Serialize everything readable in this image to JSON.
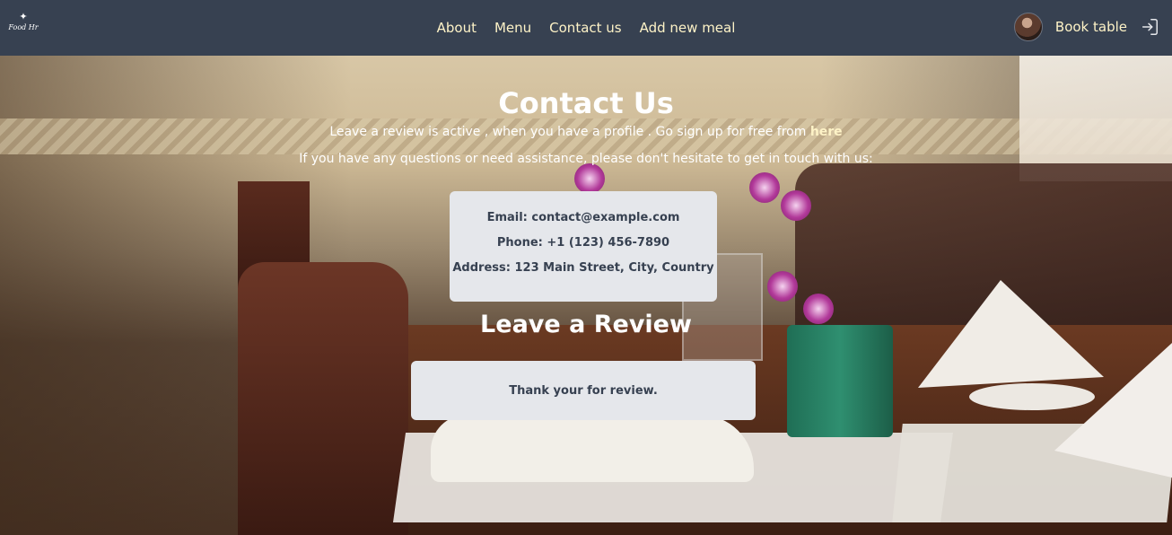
{
  "nav": {
    "logo_text": "Food Hr",
    "links": [
      "About",
      "Menu",
      "Contact us",
      "Add new meal"
    ],
    "book_table": "Book table",
    "login_icon": "login-icon"
  },
  "contact": {
    "title": "Contact Us",
    "review_notice_prefix": "Leave a review is active , when you have a profile . Go sign up for free from ",
    "review_notice_link": "here",
    "assistance": "If you have any questions or need assistance, please don't hesitate to get in touch with us:",
    "email": "Email: contact@example.com",
    "phone": "Phone: +1 (123) 456-7890",
    "address": "Address: 123 Main Street, City, Country"
  },
  "review": {
    "title": "Leave a Review",
    "message": "Thank your for review."
  },
  "colors": {
    "navbar": "#374151",
    "nav_link": "#fef3c7",
    "card": "#e5e7eb",
    "card_text": "#374151"
  }
}
